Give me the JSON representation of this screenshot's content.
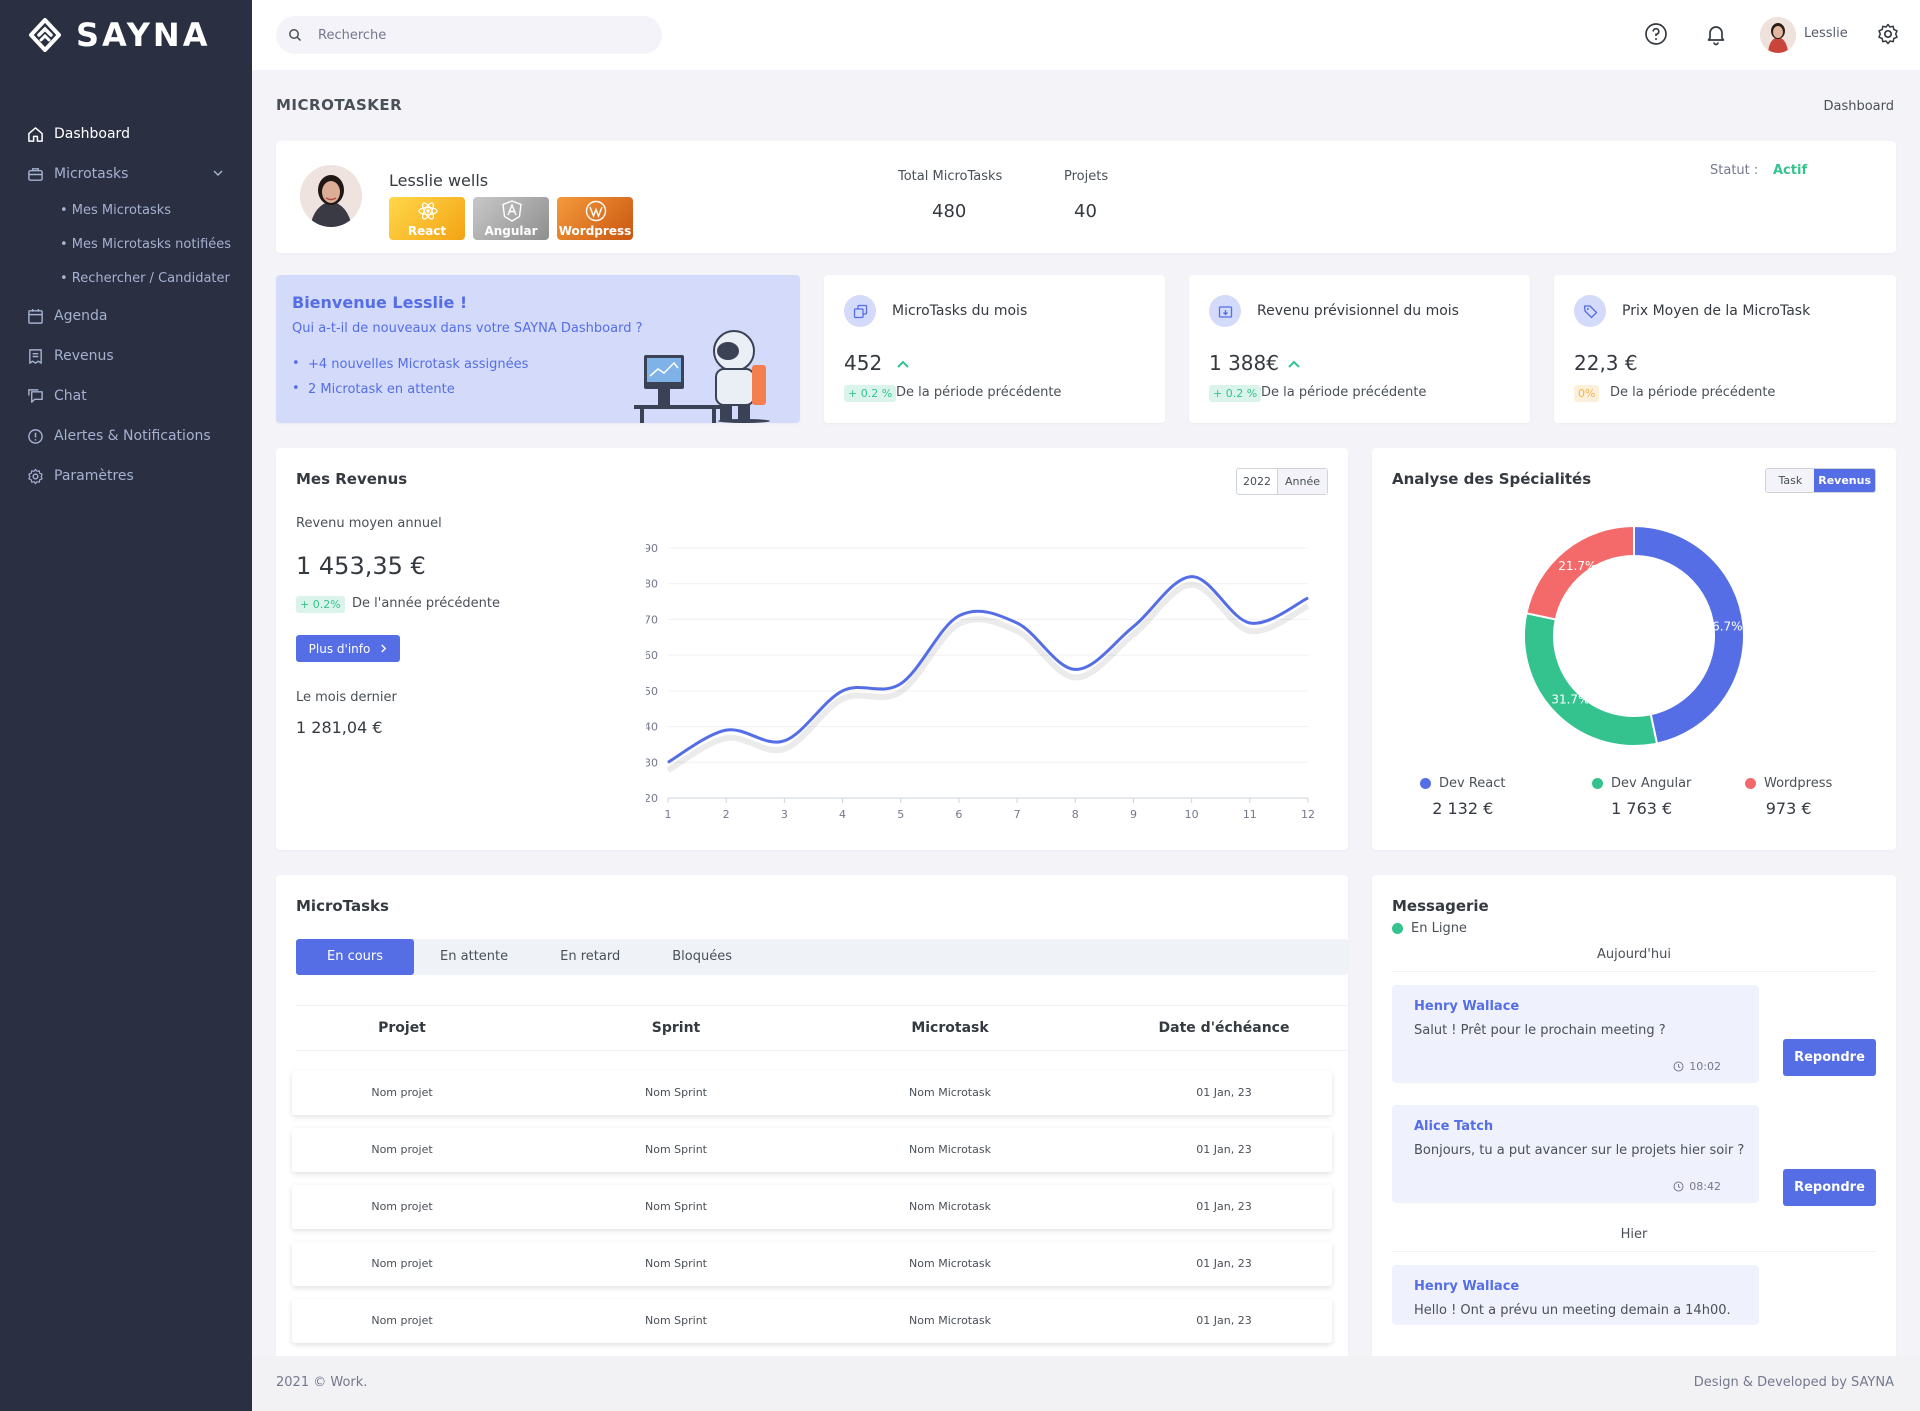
{
  "brand": {
    "name": "SAYNA"
  },
  "sidebar": {
    "items": [
      {
        "label": "Dashboard",
        "icon": "home-icon"
      },
      {
        "label": "Microtasks",
        "icon": "briefcase-icon"
      },
      {
        "label": "Agenda",
        "icon": "calendar-icon"
      },
      {
        "label": "Revenus",
        "icon": "receipt-icon"
      },
      {
        "label": "Chat",
        "icon": "chat-icon"
      },
      {
        "label": "Alertes & Notifications",
        "icon": "alert-icon"
      },
      {
        "label": "Paramètres",
        "icon": "gear-icon"
      }
    ],
    "submenu": [
      "• Mes Microtasks",
      "• Mes Microtasks notifiées",
      "• Rechercher / Candidater"
    ]
  },
  "topbar": {
    "search_placeholder": "Recherche",
    "username": "Lesslie"
  },
  "page": {
    "title": "MICROTASKER",
    "breadcrumb": "Dashboard"
  },
  "profile": {
    "name": "Lesslie wells",
    "skills": [
      "React",
      "Angular",
      "Wordpress"
    ],
    "total_label": "Total MicroTasks",
    "total_value": "480",
    "projects_label": "Projets",
    "projects_value": "40",
    "status_label": "Statut :",
    "status_value": "Actif"
  },
  "welcome": {
    "title": "Bienvenue Lesslie !",
    "subtitle": "Qui a-t-il de nouveaux dans votre SAYNA Dashboard ?",
    "items": [
      "+4 nouvelles Microtask assignées",
      "2 Microtask en attente"
    ]
  },
  "kpis": [
    {
      "title": "MicroTasks du mois",
      "value": "452",
      "badge": "+ 0.2 %",
      "period": "De la période précédente",
      "trend": "up"
    },
    {
      "title": "Revenu prévisionnel du mois",
      "value": "1 388€",
      "badge": "+ 0.2 %",
      "period": "De la période précédente",
      "trend": "up"
    },
    {
      "title": "Prix Moyen de la MicroTask",
      "value": "22,3 €",
      "badge": "0%",
      "period": "De la période précédente",
      "trend": "flat"
    }
  ],
  "revenus": {
    "title": "Mes Revenus",
    "avg_label": "Revenu moyen annuel",
    "avg_value": "1 453,35 €",
    "badge": "+ 0.2%",
    "badge_text": "De l'année précédente",
    "btn_label": "Plus d'info",
    "last_label": "Le mois dernier",
    "last_value": "1 281,04 €",
    "year": "2022",
    "year_btn": "Année"
  },
  "specialites": {
    "title": "Analyse des Spécialités",
    "toggle": [
      "Task",
      "Revenus"
    ],
    "legend": [
      {
        "name": "Dev React",
        "value": "2 132 €"
      },
      {
        "name": "Dev Angular",
        "value": "1 763 €"
      },
      {
        "name": "Wordpress",
        "value": "973 €"
      }
    ]
  },
  "chart_data": [
    {
      "type": "line",
      "x": [
        1,
        2,
        3,
        4,
        5,
        6,
        7,
        8,
        9,
        10,
        11,
        12
      ],
      "series": [
        {
          "values": [
            30,
            39,
            36,
            50,
            52,
            71,
            69,
            56,
            68,
            82,
            69,
            76
          ]
        }
      ],
      "xlabel": "",
      "ylabel": "",
      "ylim": [
        20,
        90
      ],
      "yticks": [
        20,
        30,
        40,
        50,
        60,
        70,
        80,
        90
      ],
      "grid": true,
      "color": "#556ee6"
    },
    {
      "type": "pie",
      "categories": [
        "Dev React",
        "Dev Angular",
        "Wordpress"
      ],
      "values": [
        46.7,
        31.7,
        21.7
      ],
      "labels": [
        "46.7%",
        "31.7%",
        "21.7%"
      ],
      "colors": [
        "#556ee6",
        "#34c38f",
        "#f46a6a"
      ],
      "donut": true
    }
  ],
  "microtasks": {
    "title": "MicroTasks",
    "tabs": [
      "En cours",
      "En attente",
      "En retard",
      "Bloquées"
    ],
    "columns": [
      "Projet",
      "Sprint",
      "Microtask",
      "Date d'échéance"
    ],
    "rows": [
      [
        "Nom projet",
        "Nom Sprint",
        "Nom Microtask",
        "01 Jan, 23"
      ],
      [
        "Nom projet",
        "Nom Sprint",
        "Nom Microtask",
        "01 Jan, 23"
      ],
      [
        "Nom projet",
        "Nom Sprint",
        "Nom Microtask",
        "01 Jan, 23"
      ],
      [
        "Nom projet",
        "Nom Sprint",
        "Nom Microtask",
        "01 Jan, 23"
      ],
      [
        "Nom projet",
        "Nom Sprint",
        "Nom Microtask",
        "01 Jan, 23"
      ]
    ]
  },
  "messagerie": {
    "title": "Messagerie",
    "status": "En Ligne",
    "today": "Aujourd'hui",
    "yesterday": "Hier",
    "reply_label": "Repondre",
    "messages": [
      {
        "name": "Henry Wallace",
        "text": "Salut ! Prêt pour le prochain meeting ?",
        "time": "10:02"
      },
      {
        "name": "Alice Tatch",
        "text": "Bonjours, tu a put avancer sur le projets hier soir ?",
        "time": "08:42"
      },
      {
        "name": "Henry Wallace",
        "text": "Hello ! Ont a prévu un meeting demain a 14h00."
      }
    ]
  },
  "footer": {
    "left": "2021 © Work.",
    "right": "Design & Developed by SAYNA"
  },
  "colors": {
    "primary": "#556ee6",
    "success": "#34c38f",
    "danger": "#f46a6a",
    "warning": "#f1b44c",
    "sidebar": "#2a3042"
  }
}
